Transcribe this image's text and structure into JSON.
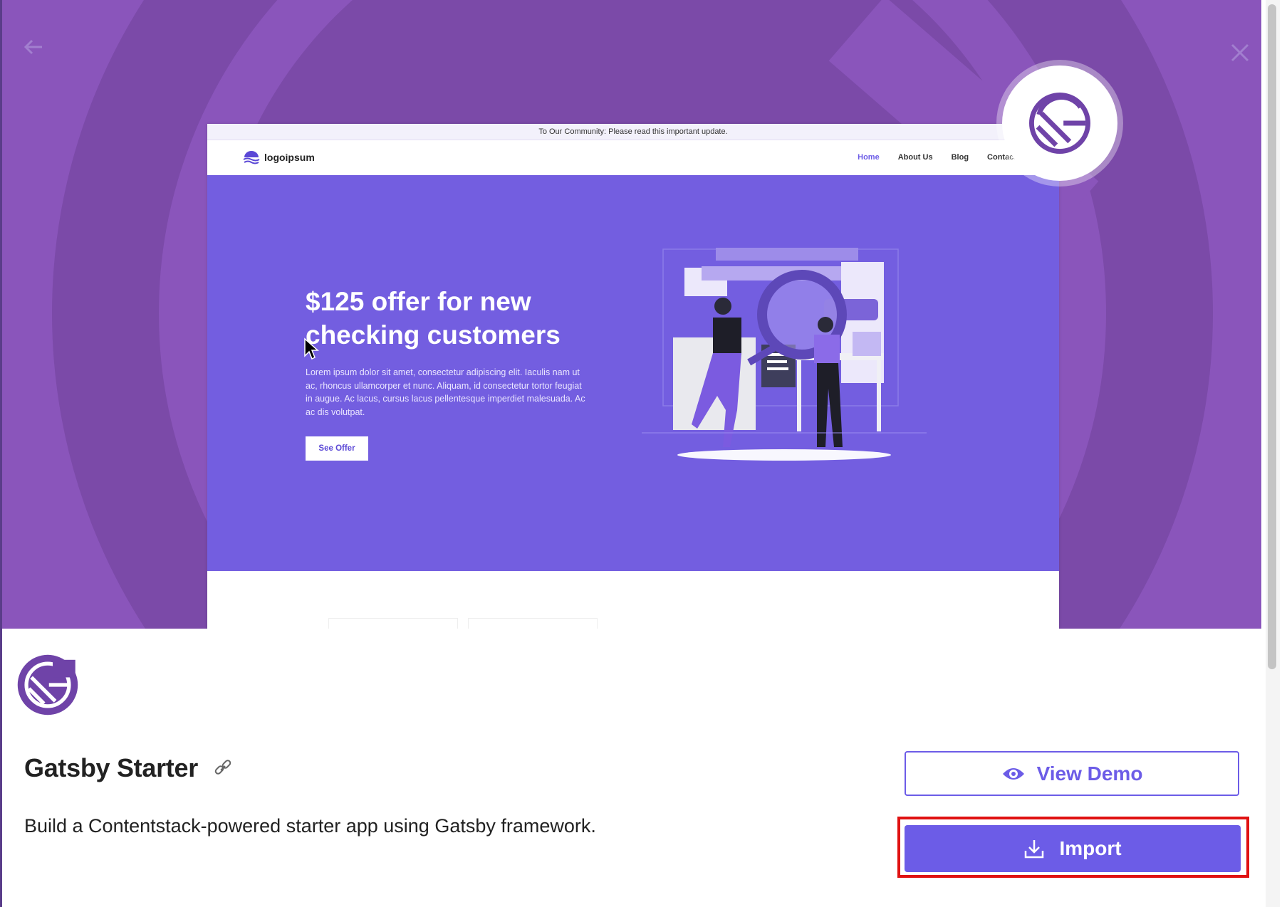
{
  "modal": {
    "back_icon": "arrow-left-icon",
    "close_icon": "close-icon",
    "accent_color": "#6c5ce7",
    "hero_color": "#8a55bb"
  },
  "preview": {
    "announcement": "To Our Community: Please read this important update.",
    "logo_text": "logoipsum",
    "nav_links": [
      "Home",
      "About Us",
      "Blog",
      "Contact"
    ],
    "headline": "$125 offer for new checking customers",
    "body": "Lorem ipsum dolor sit amet, consectetur adipiscing elit. Iaculis nam ut ac, rhoncus ullamcorper et nunc. Aliquam, id consectetur tortor feugiat in augue. Ac lacus, cursus lacus pellentesque imperdiet malesuada. Ac ac dis volutpat.",
    "cta": "See Offer"
  },
  "starter": {
    "title": "Gatsby Starter",
    "description": "Build a Contentstack-powered starter app using Gatsby framework.",
    "link_icon": "link-icon",
    "view_demo_label": "View Demo",
    "view_demo_icon": "eye-icon",
    "import_label": "Import",
    "import_icon": "download-icon"
  }
}
